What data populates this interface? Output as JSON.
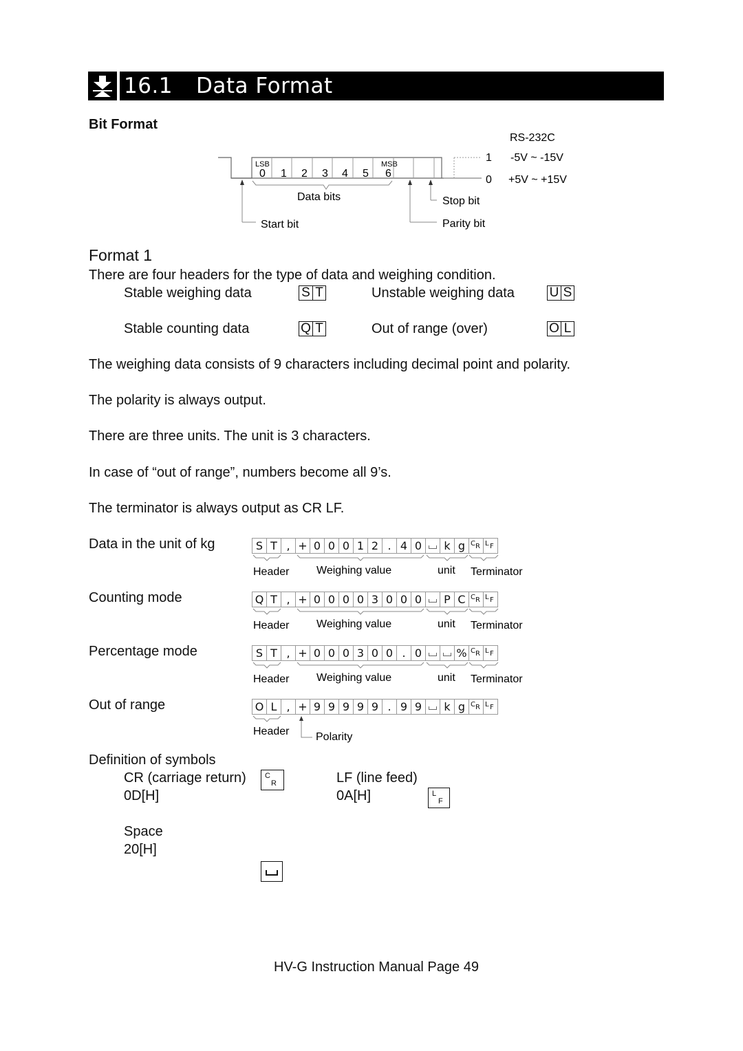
{
  "title": {
    "number": "16.1",
    "text": "Data Format",
    "icon": "weighing-pan-icon"
  },
  "bit_format": {
    "heading": "Bit Format",
    "interface": "RS-232C",
    "levels": [
      {
        "bit": "1",
        "voltage": "-5V ~  -15V"
      },
      {
        "bit": "0",
        "voltage": "+5V ~ +15V"
      }
    ],
    "data_bit_labels": [
      "0",
      "1",
      "2",
      "3",
      "4",
      "5",
      "6"
    ],
    "lsb": "LSB",
    "msb": "MSB",
    "labels": {
      "data_bits": "Data bits",
      "start_bit": "Start bit",
      "stop_bit": "Stop bit",
      "parity_bit": "Parity bit"
    }
  },
  "format1": {
    "heading": "Format 1",
    "intro": "There are four headers for the type of data and weighing condition.",
    "headers": [
      {
        "label": "Stable weighing data",
        "code": [
          "S",
          "T"
        ]
      },
      {
        "label": "Unstable weighing data",
        "code": [
          "U",
          "S"
        ]
      },
      {
        "label": "Stable counting data",
        "code": [
          "Q",
          "T"
        ]
      },
      {
        "label": "Out of range (over)",
        "code": [
          "O",
          "L"
        ]
      }
    ],
    "notes": [
      "The weighing data consists of 9 characters including decimal point and polarity.",
      "The polarity is always output.",
      "There are three units. The unit is 3 characters.",
      "In case of “out of range”, numbers become all 9’s.",
      "The terminator is always output as CR LF."
    ]
  },
  "examples": [
    {
      "label": "Data in the unit of kg",
      "chars": [
        "S",
        "T",
        ",",
        "+",
        "0",
        "0",
        "0",
        "1",
        "2",
        ".",
        "4",
        "0",
        "␣",
        "k",
        "g",
        "CR",
        "LF"
      ],
      "annotations": [
        "Header",
        "Weighing value",
        "unit",
        "Terminator"
      ]
    },
    {
      "label": "Counting mode",
      "chars": [
        "Q",
        "T",
        ",",
        "+",
        "0",
        "0",
        "0",
        "0",
        "3",
        "0",
        "0",
        "0",
        "␣",
        "P",
        "C",
        "CR",
        "LF"
      ],
      "annotations": [
        "Header",
        "Weighing value",
        "unit",
        "Terminator"
      ]
    },
    {
      "label": "Percentage mode",
      "chars": [
        "S",
        "T",
        ",",
        "+",
        "0",
        "0",
        "0",
        "3",
        "0",
        "0",
        ".",
        "0",
        "␣",
        "␣",
        "%",
        "CR",
        "LF"
      ],
      "annotations": [
        "Header",
        "Weighing value",
        "unit",
        "Terminator"
      ]
    },
    {
      "label": "Out of range",
      "chars": [
        "O",
        "L",
        ",",
        "+",
        "9",
        "9",
        "9",
        "9",
        "9",
        ".",
        "9",
        "9",
        "␣",
        "k",
        "g",
        "CR",
        "LF"
      ],
      "annotations": [
        "Header",
        "Polarity"
      ]
    }
  ],
  "symbols": {
    "heading": "Definition of symbols",
    "items": [
      {
        "name": "CR (carriage return)",
        "hex": "0D[H]",
        "glyph": [
          "C",
          "R"
        ]
      },
      {
        "name": "LF (line feed)",
        "hex": "0A[H]",
        "glyph": [
          "L",
          "F"
        ]
      },
      {
        "name": "Space",
        "hex": "20[H]",
        "glyph": [
          "␣"
        ]
      }
    ]
  },
  "footer": "HV-G Instruction Manual Page 49"
}
